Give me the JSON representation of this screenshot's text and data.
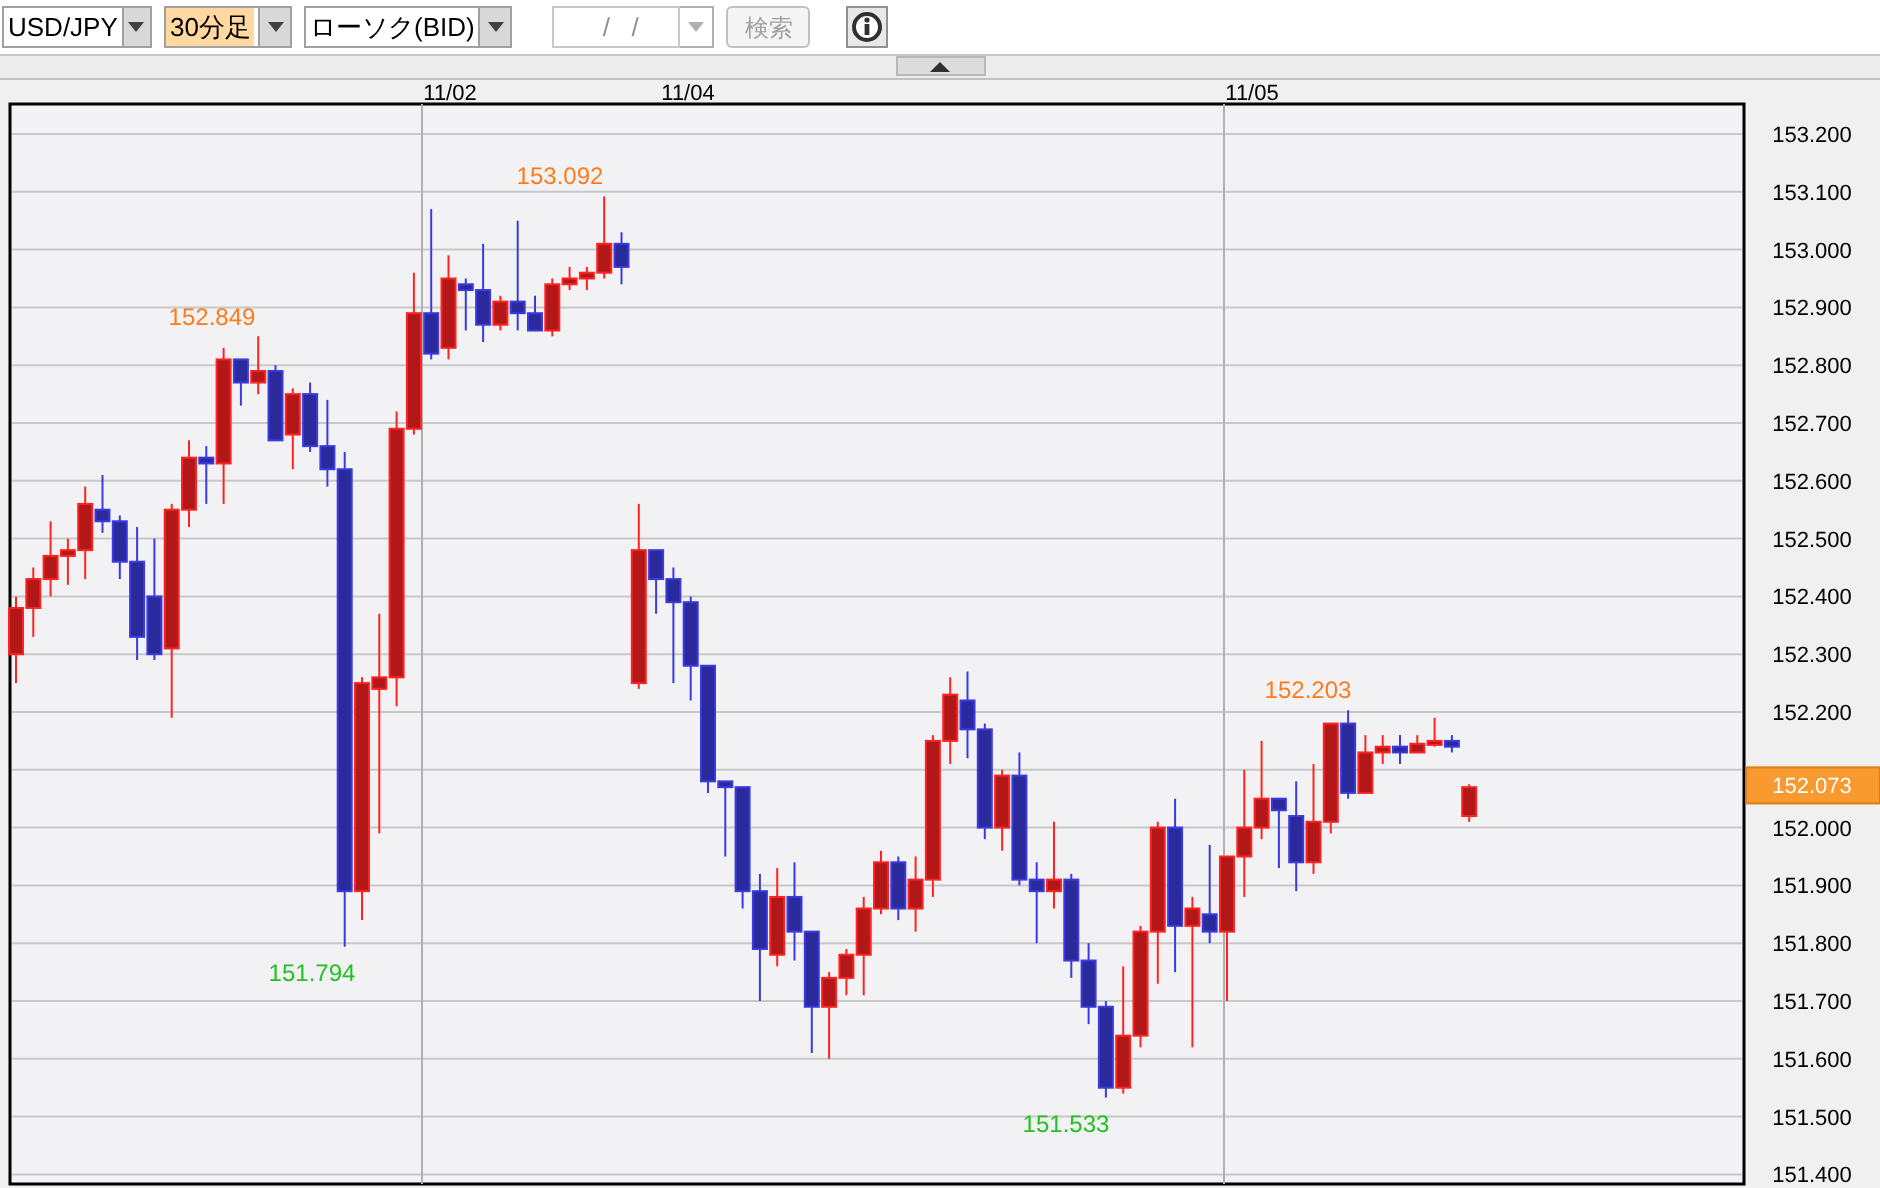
{
  "toolbar": {
    "symbol": {
      "value": "USD/JPY",
      "highlighted": false
    },
    "timeframe": {
      "value": "30分足",
      "highlighted": true
    },
    "chart_type": {
      "value": "ローソク(BID)",
      "highlighted": false
    },
    "date_field": {
      "placeholder": "/   /",
      "disabled": true
    },
    "search_button": {
      "label": "検索",
      "disabled": true
    }
  },
  "chart": {
    "x_labels": [
      "11/02",
      "11/04",
      "11/05"
    ],
    "y_ticks_above_price": [
      "153.200",
      "153.100",
      "153.000",
      "152.900",
      "152.800",
      "152.700",
      "152.600",
      "152.500",
      "152.400",
      "152.300",
      "152.200"
    ],
    "y_ticks_below_price": [
      "152.000",
      "151.900",
      "151.800",
      "151.700",
      "151.600",
      "151.500",
      "151.400"
    ],
    "annotations": [
      {
        "text": "152.849",
        "kind": "high"
      },
      {
        "text": "153.092",
        "kind": "high"
      },
      {
        "text": "151.794",
        "kind": "low"
      },
      {
        "text": "151.533",
        "kind": "low"
      },
      {
        "text": "152.203",
        "kind": "high"
      }
    ],
    "current_price": "152.073"
  }
}
